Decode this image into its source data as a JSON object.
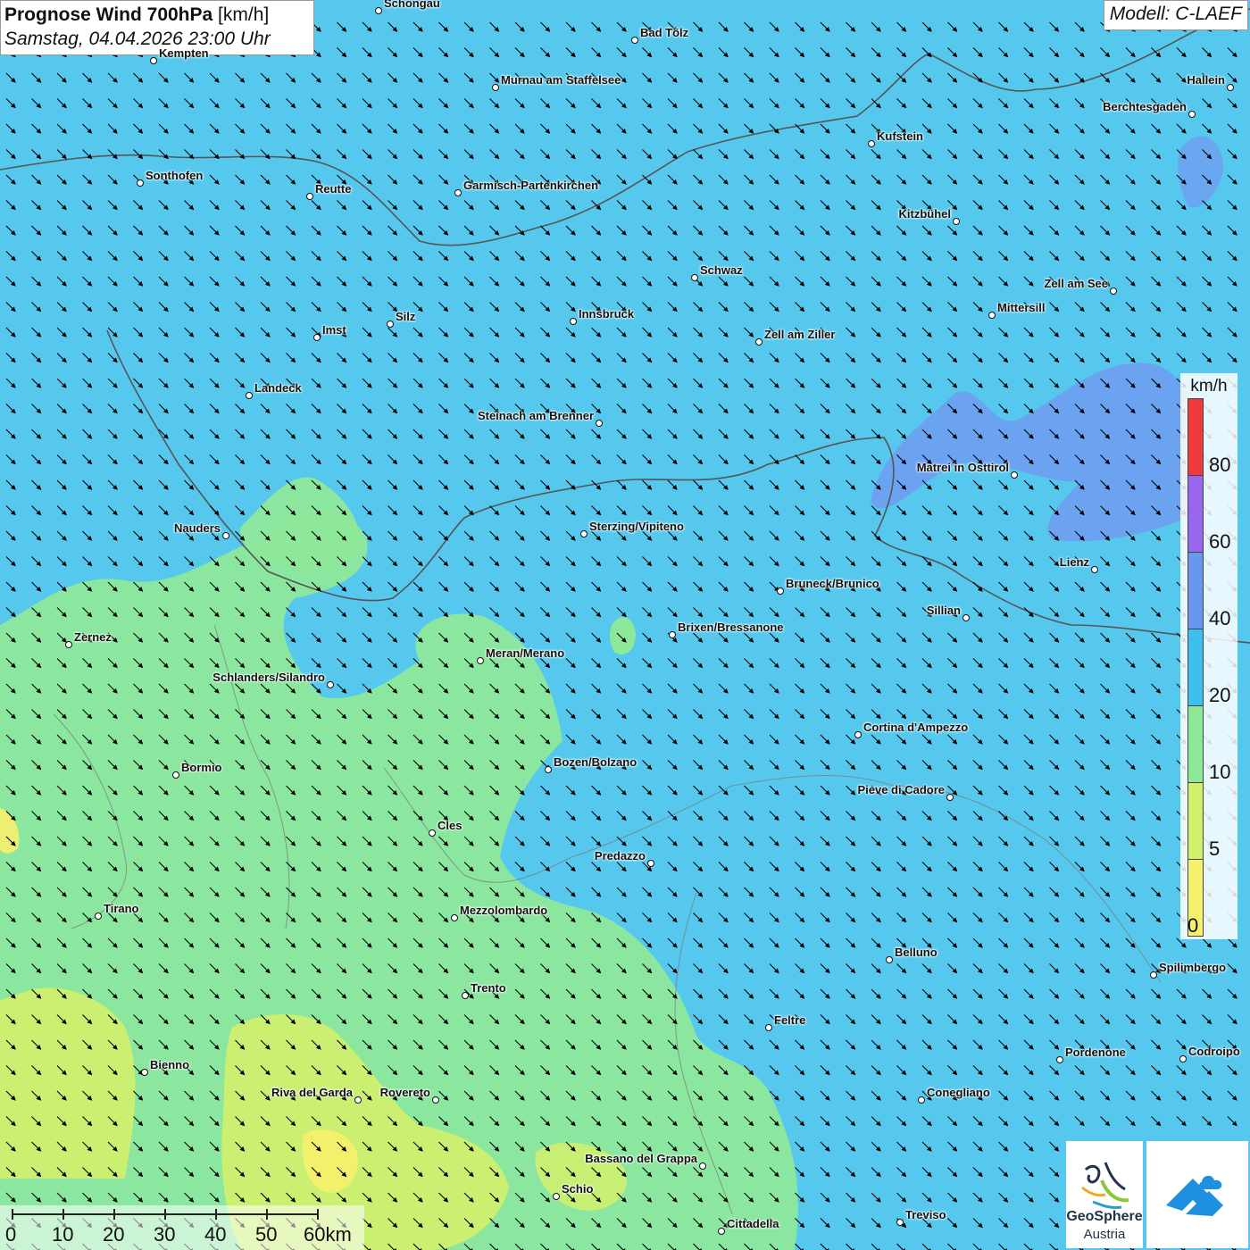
{
  "title": {
    "main": "Prognose Wind 700hPa",
    "unit": "[km/h]",
    "datetime": "Samstag, 04.04.2026 23:00 Uhr"
  },
  "model": "Modell: C-LAEF",
  "legend": {
    "unit": "km/h",
    "ticks": [
      "0",
      "5",
      "10",
      "20",
      "40",
      "60",
      "80"
    ],
    "colors": [
      "#f7f06a",
      "#d0f06c",
      "#8ee89a",
      "#3cc0ee",
      "#6699ee",
      "#9966ee",
      "#ee3a3a"
    ]
  },
  "scalebar": [
    "0",
    "10",
    "20",
    "30",
    "40",
    "50",
    "60km"
  ],
  "cities": [
    {
      "name": "Schongau"
    },
    {
      "name": "Bad Tölz"
    },
    {
      "name": "Kempten"
    },
    {
      "name": "Murnau am Staffelsee"
    },
    {
      "name": "Hallein"
    },
    {
      "name": "Berchtesgaden"
    },
    {
      "name": "Kufstein"
    },
    {
      "name": "Sonthofen"
    },
    {
      "name": "Reutte"
    },
    {
      "name": "Garmisch-Partenkirchen"
    },
    {
      "name": "Kitzbühel"
    },
    {
      "name": "Schwaz"
    },
    {
      "name": "Zell am See"
    },
    {
      "name": "Mittersill"
    },
    {
      "name": "Silz"
    },
    {
      "name": "Imst"
    },
    {
      "name": "Innsbruck"
    },
    {
      "name": "Zell am Ziller"
    },
    {
      "name": "Landeck"
    },
    {
      "name": "Steinach am Brenner"
    },
    {
      "name": "Matrei in Osttirol"
    },
    {
      "name": "Nauders"
    },
    {
      "name": "Sterzing/Vipiteno"
    },
    {
      "name": "Lienz"
    },
    {
      "name": "Bruneck/Brunico"
    },
    {
      "name": "Sillian"
    },
    {
      "name": "Zernez"
    },
    {
      "name": "Brixen/Bressanone"
    },
    {
      "name": "Meran/Merano"
    },
    {
      "name": "Schlanders/Silandro"
    },
    {
      "name": "Cortina d'Ampezzo"
    },
    {
      "name": "Bormio"
    },
    {
      "name": "Bozen/Bolzano"
    },
    {
      "name": "Pieve di Cadore"
    },
    {
      "name": "Cles"
    },
    {
      "name": "Predazzo"
    },
    {
      "name": "Tirano"
    },
    {
      "name": "Mezzolombardo"
    },
    {
      "name": "Belluno"
    },
    {
      "name": "Spilimbergo"
    },
    {
      "name": "Trento"
    },
    {
      "name": "Feltre"
    },
    {
      "name": "Pordenone"
    },
    {
      "name": "Codroipo"
    },
    {
      "name": "Bienno"
    },
    {
      "name": "Riva del Garda"
    },
    {
      "name": "Rovereto"
    },
    {
      "name": "Conegliano"
    },
    {
      "name": "Bassano del Grappa"
    },
    {
      "name": "Schio"
    },
    {
      "name": "Treviso"
    },
    {
      "name": "Cittadella"
    }
  ],
  "logos": {
    "geosphere_line1": "GeoSphere",
    "geosphere_line2": "Austria"
  }
}
